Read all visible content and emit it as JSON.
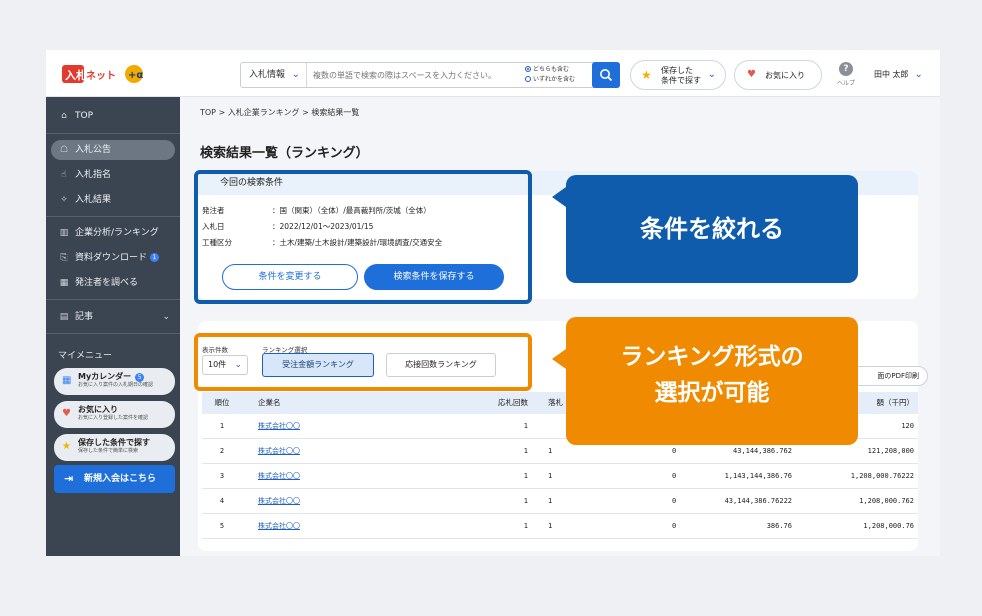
{
  "header": {
    "logo_text": "入札ネット+α",
    "search_category": "入札情報",
    "search_placeholder": "複数の単語で検索の際はスペースを入力ください。",
    "search_mode_any": "どちらも含む",
    "search_mode_either": "いずれかを含む",
    "saved_conditions_line1": "保存した",
    "saved_conditions_line2": "条件で探す",
    "favorites_label": "お気に入り",
    "help_label": "ヘルプ",
    "user_name": "田中 太郎"
  },
  "sidebar": {
    "top_label": "TOP",
    "items": [
      {
        "label": "入札公告"
      },
      {
        "label": "入札指名"
      },
      {
        "label": "入札結果"
      },
      {
        "label": "企業分析/ランキング"
      },
      {
        "label": "資料ダウンロード",
        "badge": "1"
      },
      {
        "label": "発注者を調べる"
      },
      {
        "label": "記事"
      }
    ],
    "mymenu_title": "マイメニュー",
    "mymenu": [
      {
        "title": "Myカレンダー",
        "badge": "5",
        "sub": "お気に入り案件の入札期日の確認"
      },
      {
        "title": "お気に入り",
        "sub": "お気に入り登録した案件を確認"
      },
      {
        "title": "保存した条件で探す",
        "sub": "保存した条件で簡単に検索"
      }
    ],
    "join_label": "新規入会はこちら"
  },
  "main": {
    "breadcrumb": "TOP > 入札企業ランキング > 検索結果一覧",
    "page_title": "検索結果一覧（ランキング）",
    "conditions": {
      "heading": "今回の検索条件",
      "rows": [
        {
          "key": "発注者",
          "value": "：国（関東）（全体）/最高裁判所/茨城（全体）"
        },
        {
          "key": "入札日",
          "value": "：2022/12/01〜2023/01/15"
        },
        {
          "key": "工種区分",
          "value": "：土木/建築/土木設計/建築設計/環境調査/交通安全"
        }
      ],
      "change_button": "条件を変更する",
      "save_button": "検索条件を保存する"
    },
    "result": {
      "count_label": "表示件数",
      "count_value": "10件",
      "ranking_label": "ランキング選択",
      "ranking_amount": "受注金額ランキング",
      "ranking_bids": "応接回数ランキング",
      "pdf_button": "面のPDF印刷",
      "columns": [
        "順位",
        "企業名",
        "応札回数",
        "落札",
        "額（千円）"
      ],
      "rows": [
        {
          "rank": "1",
          "company": "株式会社〇〇",
          "bids": "1",
          "wins": "",
          "zero": "",
          "amount": "",
          "amount2": "120"
        },
        {
          "rank": "2",
          "company": "株式会社〇〇",
          "bids": "1",
          "wins": "1",
          "zero": "0",
          "amount": "43,144,386.762",
          "amount2": "121,208,000"
        },
        {
          "rank": "3",
          "company": "株式会社〇〇",
          "bids": "1",
          "wins": "1",
          "zero": "0",
          "amount": "1,143,144,386.76",
          "amount2": "1,208,000.76222"
        },
        {
          "rank": "4",
          "company": "株式会社〇〇",
          "bids": "1",
          "wins": "1",
          "zero": "0",
          "amount": "43,144,386.76222",
          "amount2": "1,208,000.762"
        },
        {
          "rank": "5",
          "company": "株式会社〇〇",
          "bids": "1",
          "wins": "1",
          "zero": "0",
          "amount": "386.76",
          "amount2": "1,208,000.76"
        }
      ]
    }
  },
  "callouts": {
    "conditions": "条件を絞れる",
    "ranking_line1": "ランキング形式の",
    "ranking_line2": "選択が可能"
  },
  "colors": {
    "primary_blue": "#1e6fd9",
    "callout_blue": "#0f5cac",
    "callout_orange": "#f08a00",
    "sidebar_bg": "#3b4451"
  }
}
